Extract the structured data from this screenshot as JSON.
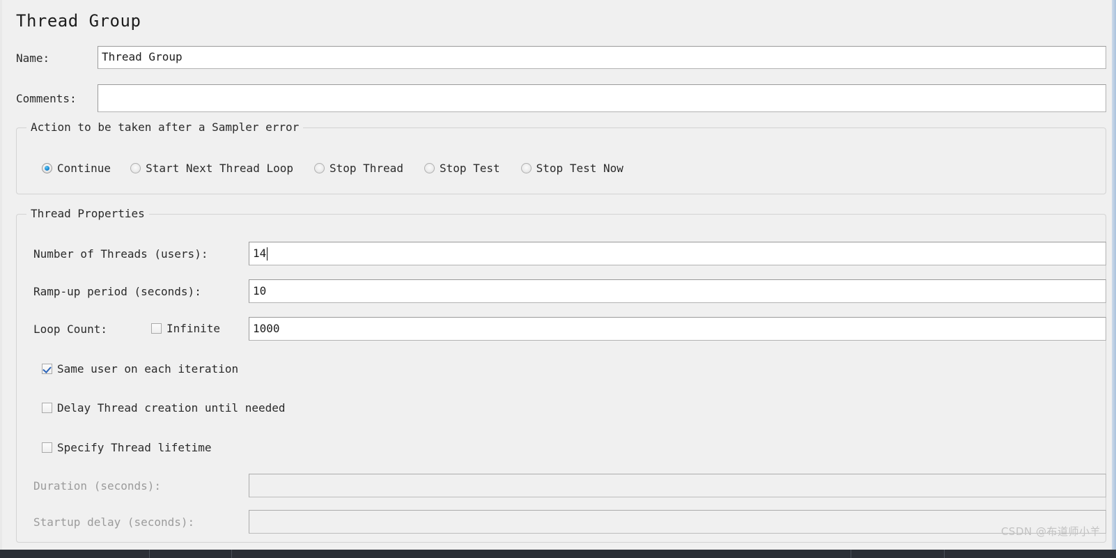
{
  "window": {
    "title": "Thread Group"
  },
  "fields": {
    "name_label": "Name:",
    "name_value": "Thread Group",
    "comments_label": "Comments:",
    "comments_value": ""
  },
  "sampler_error": {
    "group_title": "Action to be taken after a Sampler error",
    "options": [
      {
        "label": "Continue",
        "selected": true
      },
      {
        "label": "Start Next Thread Loop",
        "selected": false
      },
      {
        "label": "Stop Thread",
        "selected": false
      },
      {
        "label": "Stop Test",
        "selected": false
      },
      {
        "label": "Stop Test Now",
        "selected": false
      }
    ]
  },
  "thread_properties": {
    "group_title": "Thread Properties",
    "num_threads_label": "Number of Threads (users):",
    "num_threads_value": "14",
    "ramp_up_label": "Ramp-up period (seconds):",
    "ramp_up_value": "10",
    "loop_count_label": "Loop Count:",
    "loop_infinite_label": "Infinite",
    "loop_infinite_checked": false,
    "loop_count_value": "1000",
    "checkboxes": [
      {
        "label": "Same user on each iteration",
        "checked": true
      },
      {
        "label": "Delay Thread creation until needed",
        "checked": false
      },
      {
        "label": "Specify Thread lifetime",
        "checked": false
      }
    ],
    "duration_label": "Duration (seconds):",
    "duration_value": "",
    "duration_enabled": false,
    "startup_delay_label": "Startup delay (seconds):",
    "startup_delay_value": "",
    "startup_delay_enabled": false
  },
  "watermark": {
    "text": "CSDN @布道师小羊"
  },
  "colors": {
    "background": "#f0f0f0",
    "field_background": "#ffffff",
    "accent_radio": "#1787d2",
    "accent_check": "#2a63b8",
    "disabled_text": "#9b9b9b",
    "window_edge": "#a8c2dd"
  }
}
